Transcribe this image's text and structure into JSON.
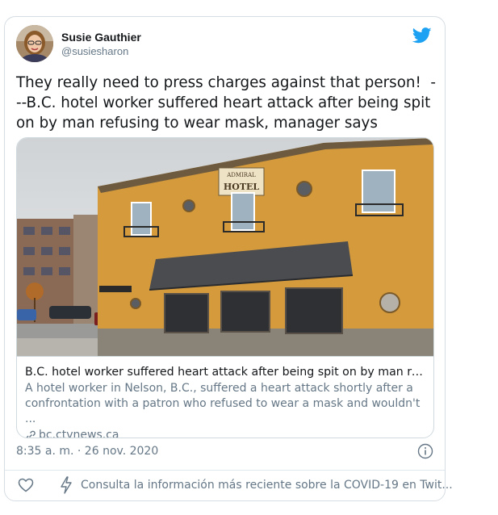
{
  "tweet": {
    "author_name": "Susie Gauthier",
    "author_handle": "@susiesharon",
    "text": "They really need to press charges against that person!  ---B.C. hotel worker suffered heart attack after being spit on by man refusing to wear mask, manager says",
    "timestamp": "8:35 a. m. · 26 nov. 2020"
  },
  "link_card": {
    "sign_top": "ADMIRAL",
    "sign_main": "HOTEL",
    "title": "B.C. hotel worker suffered heart attack after being spit on by man refusin...",
    "description": "A hotel worker in Nelson, B.C., suffered a heart attack shortly after a confrontation with a patron who refused to wear a mask and wouldn't ...",
    "domain": "bc.ctvnews.ca"
  },
  "footer": {
    "covid_notice": "Consulta la información más reciente sobre la COVID-19 en Twit..."
  },
  "icons": {
    "brand": "twitter-bird-icon",
    "like": "heart-icon",
    "info": "info-icon",
    "notice": "lightning-icon",
    "link": "link-icon"
  },
  "colors": {
    "twitter_blue": "#1da1f2",
    "secondary_text": "#657786",
    "building": "#d49a3c"
  }
}
